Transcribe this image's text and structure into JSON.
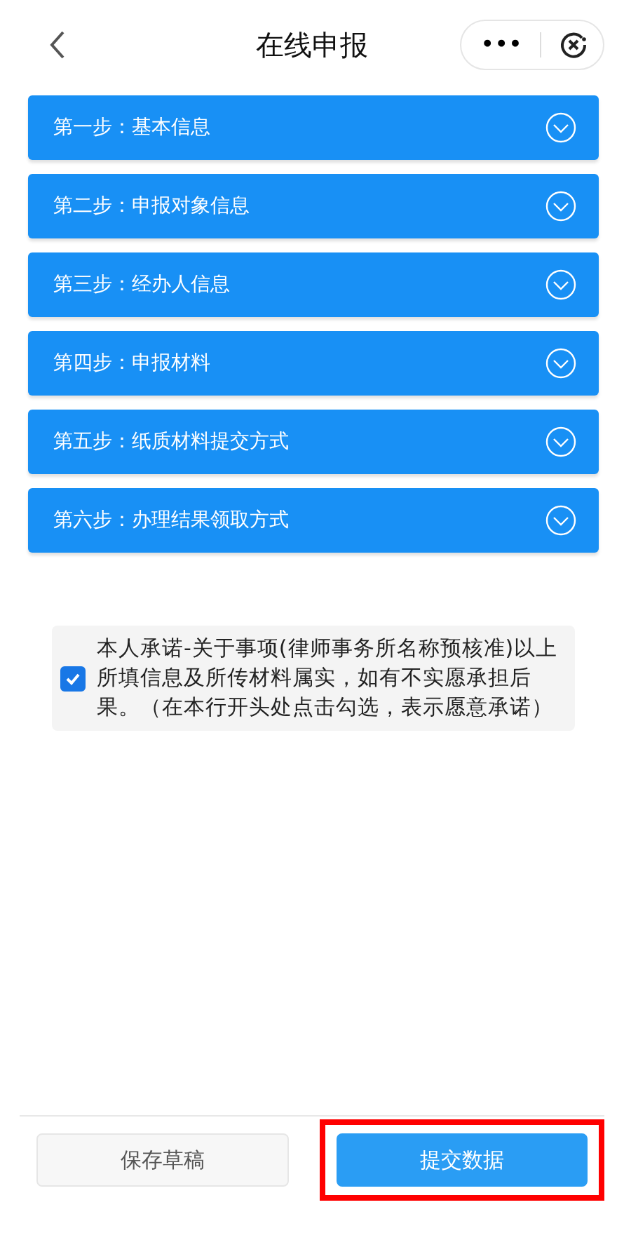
{
  "header": {
    "title": "在线申报",
    "more": "•••"
  },
  "steps": [
    {
      "label": "第一步：基本信息",
      "expanded": false
    },
    {
      "label": "第二步：申报对象信息",
      "expanded": false
    },
    {
      "label": "第三步：经办人信息",
      "expanded": false
    },
    {
      "label": "第四步：申报材料",
      "expanded": false
    },
    {
      "label": "第五步：纸质材料提交方式",
      "expanded": false
    },
    {
      "label": "第六步：办理结果领取方式",
      "expanded": false
    }
  ],
  "pledge": {
    "checked": true,
    "text": "本人承诺-关于事项(律师事务所名称预核准)以上所填信息及所传材料属实，如有不实愿承担后果。（在本行开头处点击勾选，表示愿意承诺）"
  },
  "footer": {
    "buttons": [
      {
        "label": "保存草稿",
        "kind": "secondary",
        "highlighted": false
      },
      {
        "label": "提交数据",
        "kind": "primary",
        "highlighted": true
      }
    ]
  }
}
